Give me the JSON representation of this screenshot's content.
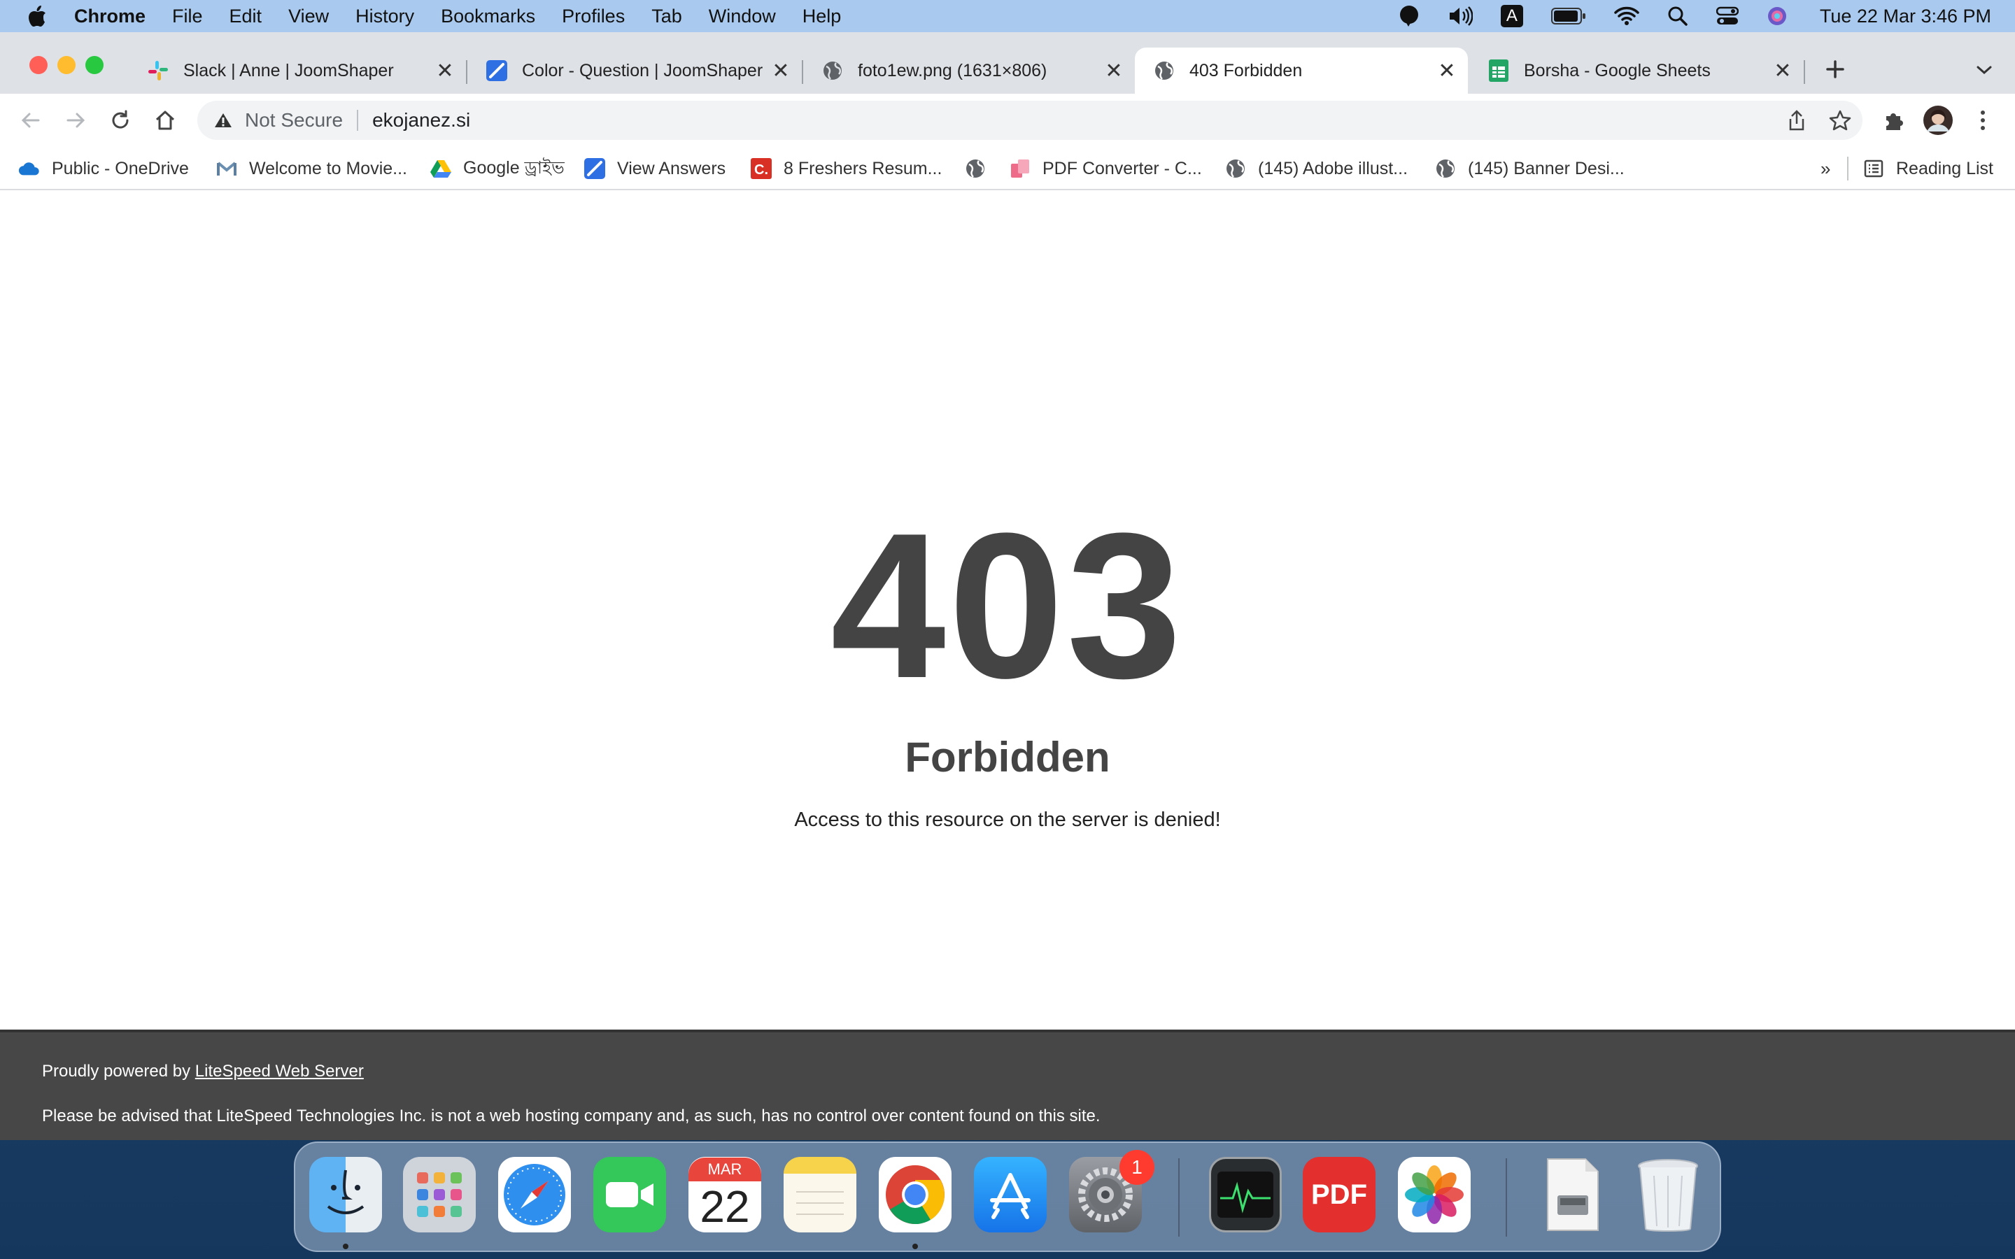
{
  "menubar": {
    "app_name": "Chrome",
    "items": [
      "File",
      "Edit",
      "View",
      "History",
      "Bookmarks",
      "Profiles",
      "Tab",
      "Window",
      "Help"
    ],
    "clock": "Tue 22 Mar  3:46 PM",
    "input_source": "A"
  },
  "tabs": [
    {
      "title": "Slack | Anne | JoomShaper",
      "icon": "slack-icon"
    },
    {
      "title": "Color - Question | JoomShaper",
      "icon": "joomshaper-icon"
    },
    {
      "title": "foto1ew.png (1631×806)",
      "icon": "globe-icon"
    },
    {
      "title": "403 Forbidden",
      "icon": "globe-icon",
      "active": true
    },
    {
      "title": "Borsha - Google Sheets",
      "icon": "sheets-icon"
    }
  ],
  "omnibox": {
    "security": "Not Secure",
    "url": "ekojanez.si"
  },
  "bookmarks": [
    {
      "label": "Public - OneDrive",
      "icon": "onedrive-icon"
    },
    {
      "label": "Welcome to Movie...",
      "icon": "gmail-icon"
    },
    {
      "label": "Google ড্রাইভ",
      "icon": "google-drive-icon"
    },
    {
      "label": "View Answers",
      "icon": "joomshaper-icon"
    },
    {
      "label": "8 Freshers Resum...",
      "icon": "c-icon"
    },
    {
      "label": "",
      "icon": "globe-icon"
    },
    {
      "label": "PDF Converter - C...",
      "icon": "pdf-converter-icon"
    },
    {
      "label": "(145) Adobe illust...",
      "icon": "globe-icon"
    },
    {
      "label": "(145) Banner Desi...",
      "icon": "globe-icon"
    }
  ],
  "bookmarks_more": "»",
  "reading_list": "Reading List",
  "page": {
    "code": "403",
    "title": "Forbidden",
    "message": "Access to this resource on the server is denied!",
    "footer_prefix": "Proudly powered by ",
    "footer_link": "LiteSpeed Web Server",
    "footer_notice": "Please be advised that LiteSpeed Technologies Inc. is not a web hosting company and, as such, has no control over content found on this site."
  },
  "dock": {
    "calendar_month": "MAR",
    "calendar_day": "22",
    "settings_badge": "1",
    "pdf_label": "PDF"
  },
  "colors": {
    "menubar": "#a9c9ee",
    "tabstrip": "#dee1e6",
    "footer": "#474747",
    "error_text": "#444444"
  }
}
